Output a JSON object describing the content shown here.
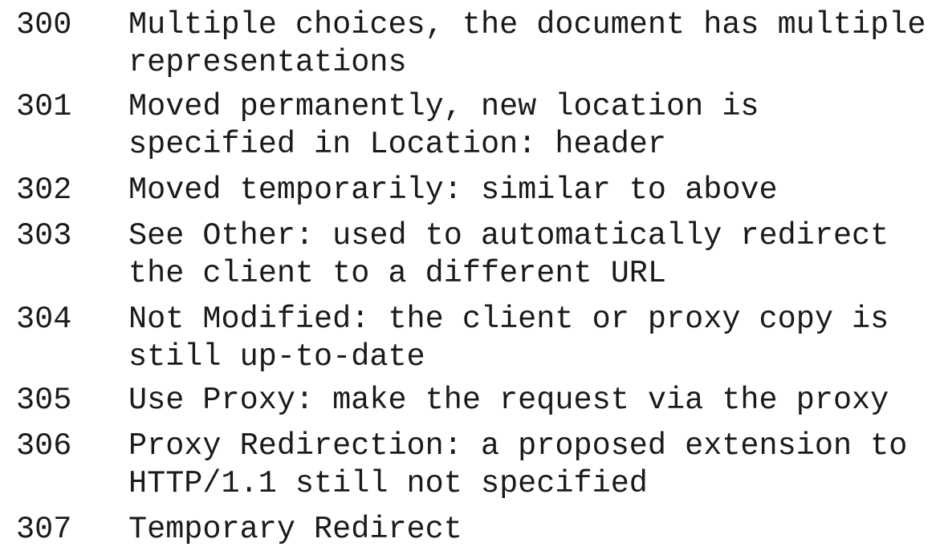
{
  "status_codes": [
    {
      "code": "300",
      "lines": [
        "Multiple choices, the document has multiple",
        "representations"
      ]
    },
    {
      "code": "301",
      "lines": [
        "Moved permanently, new location is",
        "specified in Location: header"
      ]
    },
    {
      "code": "302",
      "lines": [
        "Moved temporarily: similar to above"
      ]
    },
    {
      "code": "303",
      "lines": [
        "See Other: used to automatically redirect",
        "the client to a different URL"
      ]
    },
    {
      "code": "304",
      "lines": [
        "Not Modified: the client or proxy copy is",
        "still up-to-date"
      ]
    },
    {
      "code": "305",
      "lines": [
        "Use Proxy: make the request via the proxy"
      ]
    },
    {
      "code": "306",
      "lines": [
        "Proxy Redirection: a proposed extension to",
        "HTTP/1.1 still not specified"
      ]
    },
    {
      "code": "307",
      "lines": [
        "Temporary Redirect"
      ]
    }
  ]
}
